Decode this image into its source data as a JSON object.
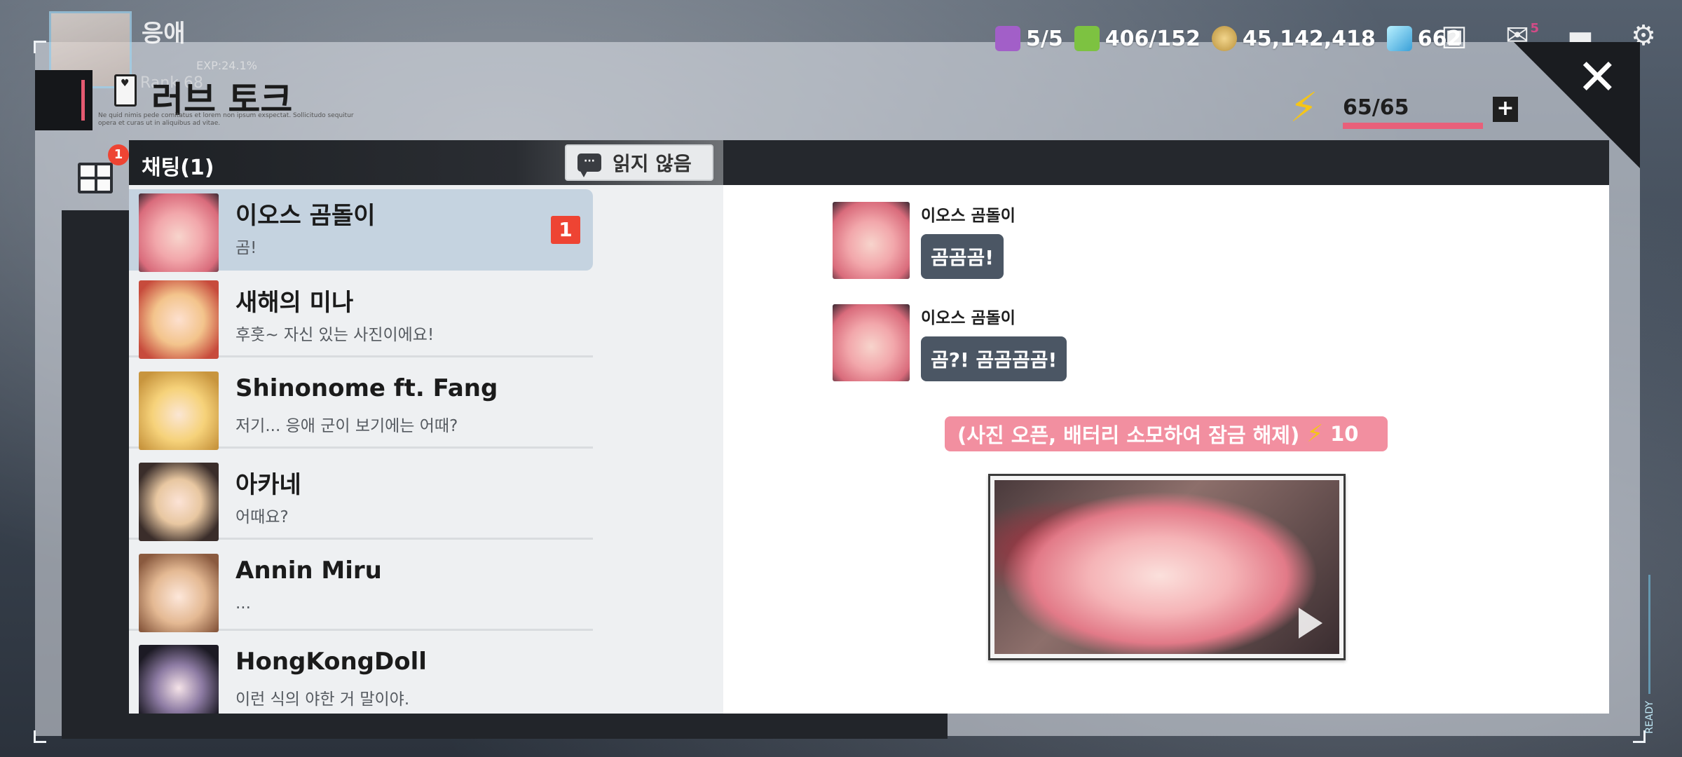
{
  "player": {
    "name": "응애",
    "exp": "EXP:24.1%",
    "rank": "Rank 68"
  },
  "resources": [
    {
      "icon": "ticket-icon",
      "value": "5/5"
    },
    {
      "icon": "battery-icon",
      "value": "406/152"
    },
    {
      "icon": "coin-icon",
      "value": "45,142,418"
    },
    {
      "icon": "gem-icon",
      "value": "662"
    }
  ],
  "top_icons": {
    "shop": "shop-icon",
    "mail": "mail-icon",
    "mail_badge": "5",
    "chat": "chat-icon",
    "settings": "settings-icon"
  },
  "dialog": {
    "title": "러브 토크",
    "subtitle": "Ne quid nimis pede comitatus et lorem non ipsum exspectat. Sollicitudo sequitur opera et curas ut in aliquibus ad vitae.",
    "close_label": "✕"
  },
  "energy": {
    "value": "65/65",
    "fill_fraction": 1.0,
    "plus_label": "+"
  },
  "side_tabs": {
    "grid_badge": "1",
    "chat_badge": "1"
  },
  "chat_list": {
    "header": "채팅(1)",
    "unread_button": "읽지 않음",
    "items": [
      {
        "name": "이오스 곰돌이",
        "message": "곰!",
        "badge": "1",
        "active": true
      },
      {
        "name": "새해의 미나",
        "message": "후훗~ 자신 있는 사진이에요!"
      },
      {
        "name": "Shinonome ft. Fang",
        "message": "저기... 응애 군이 보기에는 어때?"
      },
      {
        "name": "아카네",
        "message": "어때요?"
      },
      {
        "name": "Annin Miru",
        "message": "..."
      },
      {
        "name": "HongKongDoll",
        "message": "이런 식의 야한 거 말이야."
      }
    ]
  },
  "conversation": {
    "messages": [
      {
        "sender": "이오스 곰돌이",
        "text": "곰곰곰!"
      },
      {
        "sender": "이오스 곰돌이",
        "text": "곰?! 곰곰곰곰!"
      }
    ],
    "unlock_text": "(사진 오픈, 배터리 소모하여 잠금 해제)",
    "unlock_cost": "10"
  },
  "status_text": "READY"
}
